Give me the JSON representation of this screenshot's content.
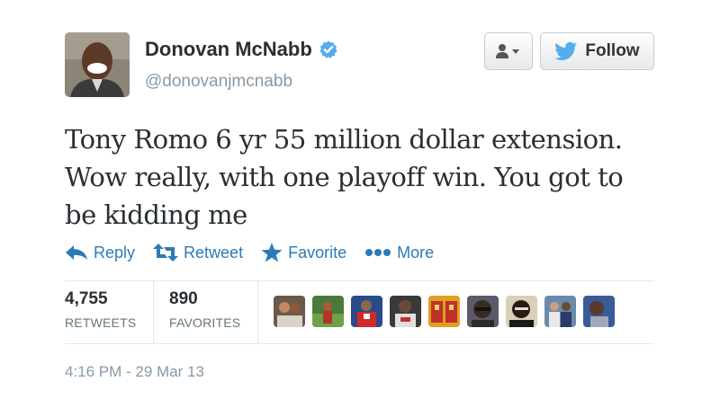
{
  "user": {
    "name": "Donovan McNabb",
    "handle": "@donovanjmcnabb",
    "verified_icon": "verified-badge-icon",
    "avatar_icon": "profile-photo"
  },
  "header": {
    "follow_label": "Follow",
    "user_menu_icon": "user-dropdown-icon"
  },
  "tweet": {
    "text": "Tony Romo 6 yr 55 million dollar extension. Wow really, with one playoff win. You got to be kidding me"
  },
  "actions": [
    {
      "label": "Reply",
      "icon": "reply-icon"
    },
    {
      "label": "Retweet",
      "icon": "retweet-icon"
    },
    {
      "label": "Favorite",
      "icon": "star-icon"
    },
    {
      "label": "More",
      "icon": "more-dots-icon"
    }
  ],
  "stats": {
    "retweets": {
      "count": "4,755",
      "label": "RETWEETS"
    },
    "favorites": {
      "count": "890",
      "label": "FAVORITES"
    }
  },
  "timestamp": "4:16 PM - 29 Mar 13",
  "colors": {
    "link_blue": "#2b7bb9",
    "twitter_blue": "#55acee",
    "muted": "#8899a6",
    "text": "#292f33"
  }
}
